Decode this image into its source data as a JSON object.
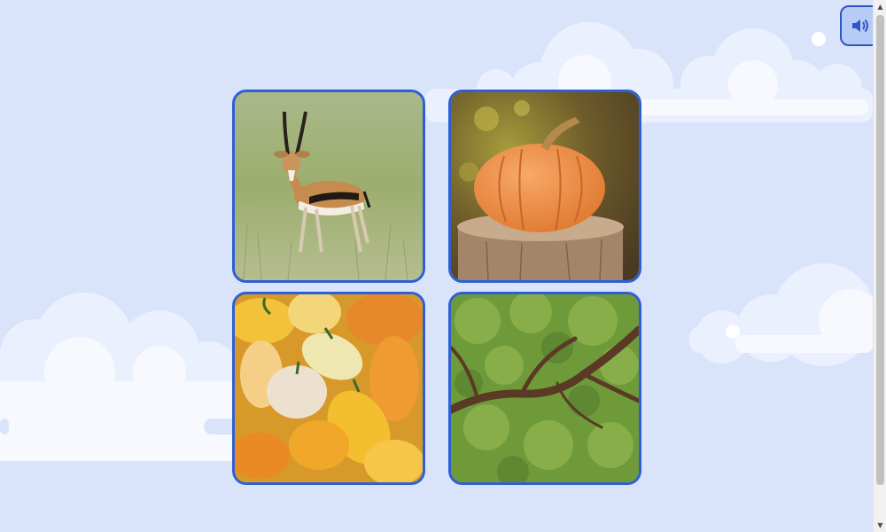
{
  "controls": {
    "sound_icon": "speaker-volume-icon"
  },
  "cards": [
    {
      "subject": "antelope"
    },
    {
      "subject": "pumpkin"
    },
    {
      "subject": "gourds"
    },
    {
      "subject": "tree"
    }
  ],
  "colors": {
    "background": "#d9e4fb",
    "cloud": "#eef3fe",
    "card_border": "#2f5fd4",
    "button_fill": "#b6ccf6"
  },
  "scrollbar": {
    "up_arrow": "▲",
    "down_arrow": "▼"
  }
}
